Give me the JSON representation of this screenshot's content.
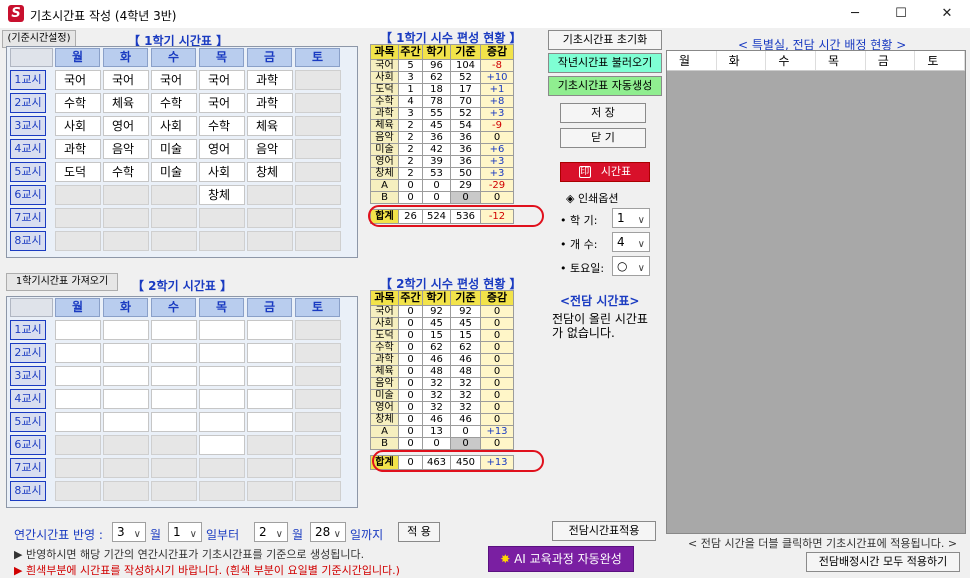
{
  "window": {
    "title": "기초시간표 작성 (4학년 3반)",
    "minimize": "─",
    "maximize": "☐",
    "close": "✕"
  },
  "top": {
    "base_time_btn": "(기준시간설정)",
    "sem1_title": "【 1학기 시간표 】",
    "sem1_import": "1학기시간표 가져오기",
    "sem2_title": "【 2학기 시간표 】"
  },
  "days": [
    "월",
    "화",
    "수",
    "목",
    "금",
    "토"
  ],
  "periods": [
    "1교시",
    "2교시",
    "3교시",
    "4교시",
    "5교시",
    "6교시",
    "7교시",
    "8교시"
  ],
  "sem1_grid": [
    [
      "국어",
      "국어",
      "국어",
      "국어",
      "과학",
      ""
    ],
    [
      "수학",
      "체육",
      "수학",
      "국어",
      "과학",
      ""
    ],
    [
      "사회",
      "영어",
      "사회",
      "수학",
      "체육",
      ""
    ],
    [
      "과학",
      "음악",
      "미술",
      "영어",
      "음악",
      ""
    ],
    [
      "도덕",
      "수학",
      "미술",
      "사회",
      "창체",
      ""
    ],
    [
      "",
      "",
      "",
      "창체",
      "",
      ""
    ],
    [
      "",
      "",
      "",
      "",
      "",
      ""
    ],
    [
      "",
      "",
      "",
      "",
      "",
      ""
    ]
  ],
  "sem2_grid": [
    [
      "",
      "",
      "",
      "",
      "",
      ""
    ],
    [
      "",
      "",
      "",
      "",
      "",
      ""
    ],
    [
      "",
      "",
      "",
      "",
      "",
      ""
    ],
    [
      "",
      "",
      "",
      "",
      "",
      ""
    ],
    [
      "",
      "",
      "",
      "",
      "",
      ""
    ],
    [
      "",
      "",
      "",
      "",
      "",
      ""
    ],
    [
      "",
      "",
      "",
      "",
      "",
      ""
    ],
    [
      "",
      "",
      "",
      "",
      "",
      ""
    ]
  ],
  "sem1_status": {
    "title": "【 1학기 시수 편성 현황 】",
    "headers": [
      "과목",
      "주간",
      "학기",
      "기준",
      "증감"
    ],
    "rows": [
      [
        "국어",
        "5",
        "96",
        "104",
        "-8"
      ],
      [
        "사회",
        "3",
        "62",
        "52",
        "+10"
      ],
      [
        "도덕",
        "1",
        "18",
        "17",
        "+1"
      ],
      [
        "수학",
        "4",
        "78",
        "70",
        "+8"
      ],
      [
        "과학",
        "3",
        "55",
        "52",
        "+3"
      ],
      [
        "체육",
        "2",
        "45",
        "54",
        "-9"
      ],
      [
        "음악",
        "2",
        "36",
        "36",
        "0"
      ],
      [
        "미술",
        "2",
        "42",
        "36",
        "+6"
      ],
      [
        "영어",
        "2",
        "39",
        "36",
        "+3"
      ],
      [
        "창체",
        "2",
        "53",
        "50",
        "+3"
      ],
      [
        "A",
        "0",
        "0",
        "29",
        "-29"
      ],
      [
        "B",
        "0",
        "0",
        "0",
        "0"
      ]
    ],
    "total": [
      "합계",
      "26",
      "524",
      "536",
      "-12"
    ]
  },
  "sem2_status": {
    "title": "【 2학기 시수 편성 현황 】",
    "headers": [
      "과목",
      "주간",
      "학기",
      "기준",
      "증감"
    ],
    "rows": [
      [
        "국어",
        "0",
        "92",
        "92",
        "0"
      ],
      [
        "사회",
        "0",
        "45",
        "45",
        "0"
      ],
      [
        "도덕",
        "0",
        "15",
        "15",
        "0"
      ],
      [
        "수학",
        "0",
        "62",
        "62",
        "0"
      ],
      [
        "과학",
        "0",
        "46",
        "46",
        "0"
      ],
      [
        "체육",
        "0",
        "48",
        "48",
        "0"
      ],
      [
        "음악",
        "0",
        "32",
        "32",
        "0"
      ],
      [
        "미술",
        "0",
        "32",
        "32",
        "0"
      ],
      [
        "영어",
        "0",
        "32",
        "32",
        "0"
      ],
      [
        "창체",
        "0",
        "46",
        "46",
        "0"
      ],
      [
        "A",
        "0",
        "13",
        "0",
        "+13"
      ],
      [
        "B",
        "0",
        "0",
        "0",
        "0"
      ]
    ],
    "total": [
      "합계",
      "0",
      "463",
      "450",
      "+13"
    ]
  },
  "side": {
    "reset": "기초시간표 초기화",
    "load_prev": "작년시간표 불러오기",
    "auto_gen": "기초시간표 자동생성",
    "save": "저 장",
    "close": "닫 기",
    "print_btn": "시간표",
    "print_opt_title": "◈ 인쇄옵션",
    "semester_label": "• 학 기:",
    "semester_val": "1",
    "count_label": "• 개 수:",
    "count_val": "4",
    "sat_label": "• 토요일:",
    "sat_val": "○",
    "dedicated_title": "<전담 시간표>",
    "dedicated_msg": "전담이 올린 시간표가 없습니다.",
    "dedicated_apply": "전담시간표적용",
    "ai_btn": "AI 교육과정 자동완성"
  },
  "right": {
    "title": "< 특별실, 전담 시간 배정 현황 >",
    "headers": [
      "월",
      "화",
      "수",
      "목",
      "금",
      "토"
    ],
    "hint": "< 전담 시간을 더블 클릭하면 기초시간표에 적용됩니다. >",
    "apply_all": "전담배정시간 모두 적용하기"
  },
  "bottom": {
    "annual_label": "연간시간표 반영 :",
    "month_from": "3",
    "month_unit": "월",
    "day_from": "1",
    "from_text": "일부터",
    "month_to": "2",
    "day_to": "28",
    "to_text": "일까지",
    "apply": "적 용",
    "note1": "▶ 반영하시면 해당 기간의 연간시간표가 기초시간표를 기준으로 생성됩니다.",
    "note2": "▶ 흰색부분에 시간표를 작성하시기 바랍니다. (흰색 부분이 요일별 기준시간입니다.)"
  },
  "colors": {
    "accent_blue": "#1a3bc1",
    "red": "#d00000",
    "header_yellow": "#f2e34a",
    "print_red": "#d8102a",
    "ai_purple": "#7a1fa2",
    "load_cyan": "#7fffd4",
    "gen_green": "#90ee90"
  }
}
